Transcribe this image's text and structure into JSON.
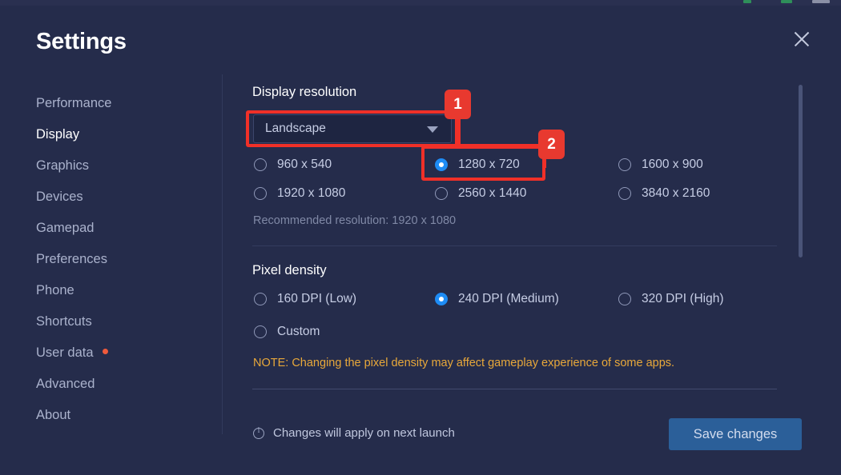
{
  "window": {
    "title": "Settings",
    "close_icon": "close-icon"
  },
  "sidebar": {
    "items": [
      {
        "label": "Performance",
        "active": false,
        "dot": false
      },
      {
        "label": "Display",
        "active": true,
        "dot": false
      },
      {
        "label": "Graphics",
        "active": false,
        "dot": false
      },
      {
        "label": "Devices",
        "active": false,
        "dot": false
      },
      {
        "label": "Gamepad",
        "active": false,
        "dot": false
      },
      {
        "label": "Preferences",
        "active": false,
        "dot": false
      },
      {
        "label": "Phone",
        "active": false,
        "dot": false
      },
      {
        "label": "Shortcuts",
        "active": false,
        "dot": false
      },
      {
        "label": "User data",
        "active": false,
        "dot": true
      },
      {
        "label": "Advanced",
        "active": false,
        "dot": false
      },
      {
        "label": "About",
        "active": false,
        "dot": false
      }
    ]
  },
  "display_section": {
    "heading": "Display resolution",
    "orientation_select": {
      "value": "Landscape",
      "caret_icon": "chevron-down-icon"
    },
    "resolutions": [
      {
        "label": "960 x 540",
        "selected": false
      },
      {
        "label": "1280 x 720",
        "selected": true
      },
      {
        "label": "1600 x 900",
        "selected": false
      },
      {
        "label": "1920 x 1080",
        "selected": false
      },
      {
        "label": "2560 x 1440",
        "selected": false
      },
      {
        "label": "3840 x 2160",
        "selected": false
      }
    ],
    "recommended": "Recommended resolution: 1920 x 1080"
  },
  "density_section": {
    "heading": "Pixel density",
    "options": [
      {
        "label": "160 DPI (Low)",
        "selected": false
      },
      {
        "label": "240 DPI (Medium)",
        "selected": true
      },
      {
        "label": "320 DPI (High)",
        "selected": false
      },
      {
        "label": "Custom",
        "selected": false
      }
    ],
    "note": "NOTE: Changing the pixel density may affect gameplay experience of some apps."
  },
  "footer": {
    "info_icon": "info-icon",
    "message": "Changes will apply on next launch",
    "save_label": "Save changes"
  },
  "annotations": [
    {
      "number": "1",
      "target": "orientation-select"
    },
    {
      "number": "2",
      "target": "resolution-1280x720"
    }
  ],
  "colors": {
    "background": "#252c4b",
    "accent_blue": "#1e8cf5",
    "active_underline": "#1e7ee8",
    "note_amber": "#e8a83a",
    "badge_red": "#e8392f",
    "annotation_red": "#f03028",
    "save_button": "#2b5f99",
    "user_data_dot": "#ef5a3c"
  }
}
